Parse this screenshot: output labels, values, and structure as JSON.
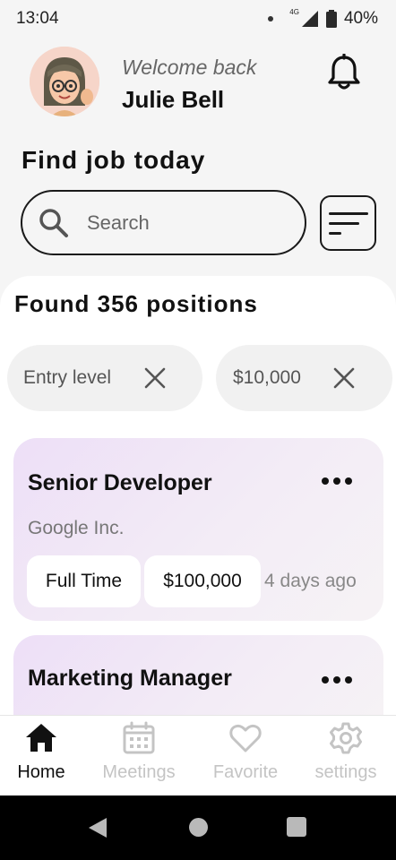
{
  "status_bar": {
    "time": "13:04",
    "network": "4G",
    "battery": "40%"
  },
  "header": {
    "welcome": "Welcome back",
    "username": "Julie Bell"
  },
  "search": {
    "title": "Find job today",
    "placeholder": "Search"
  },
  "results": {
    "found_text": "Found 356 positions",
    "filters": [
      {
        "label": "Entry level"
      },
      {
        "label": "$10,000"
      }
    ]
  },
  "jobs": [
    {
      "title": "Senior Developer",
      "company": "Google Inc.",
      "type": "Full Time",
      "salary": "$100,000",
      "posted": "4 days ago"
    },
    {
      "title": "Marketing Manager"
    }
  ],
  "bottom_nav": [
    {
      "label": "Home",
      "icon": "home-icon",
      "active": true
    },
    {
      "label": "Meetings",
      "icon": "calendar-icon",
      "active": false
    },
    {
      "label": "Favorite",
      "icon": "heart-icon",
      "active": false
    },
    {
      "label": "settings",
      "icon": "gear-icon",
      "active": false
    }
  ],
  "colors": {
    "active": "#111111",
    "inactive": "#c4c4c4",
    "card_gradient_start": "#eddff7"
  }
}
